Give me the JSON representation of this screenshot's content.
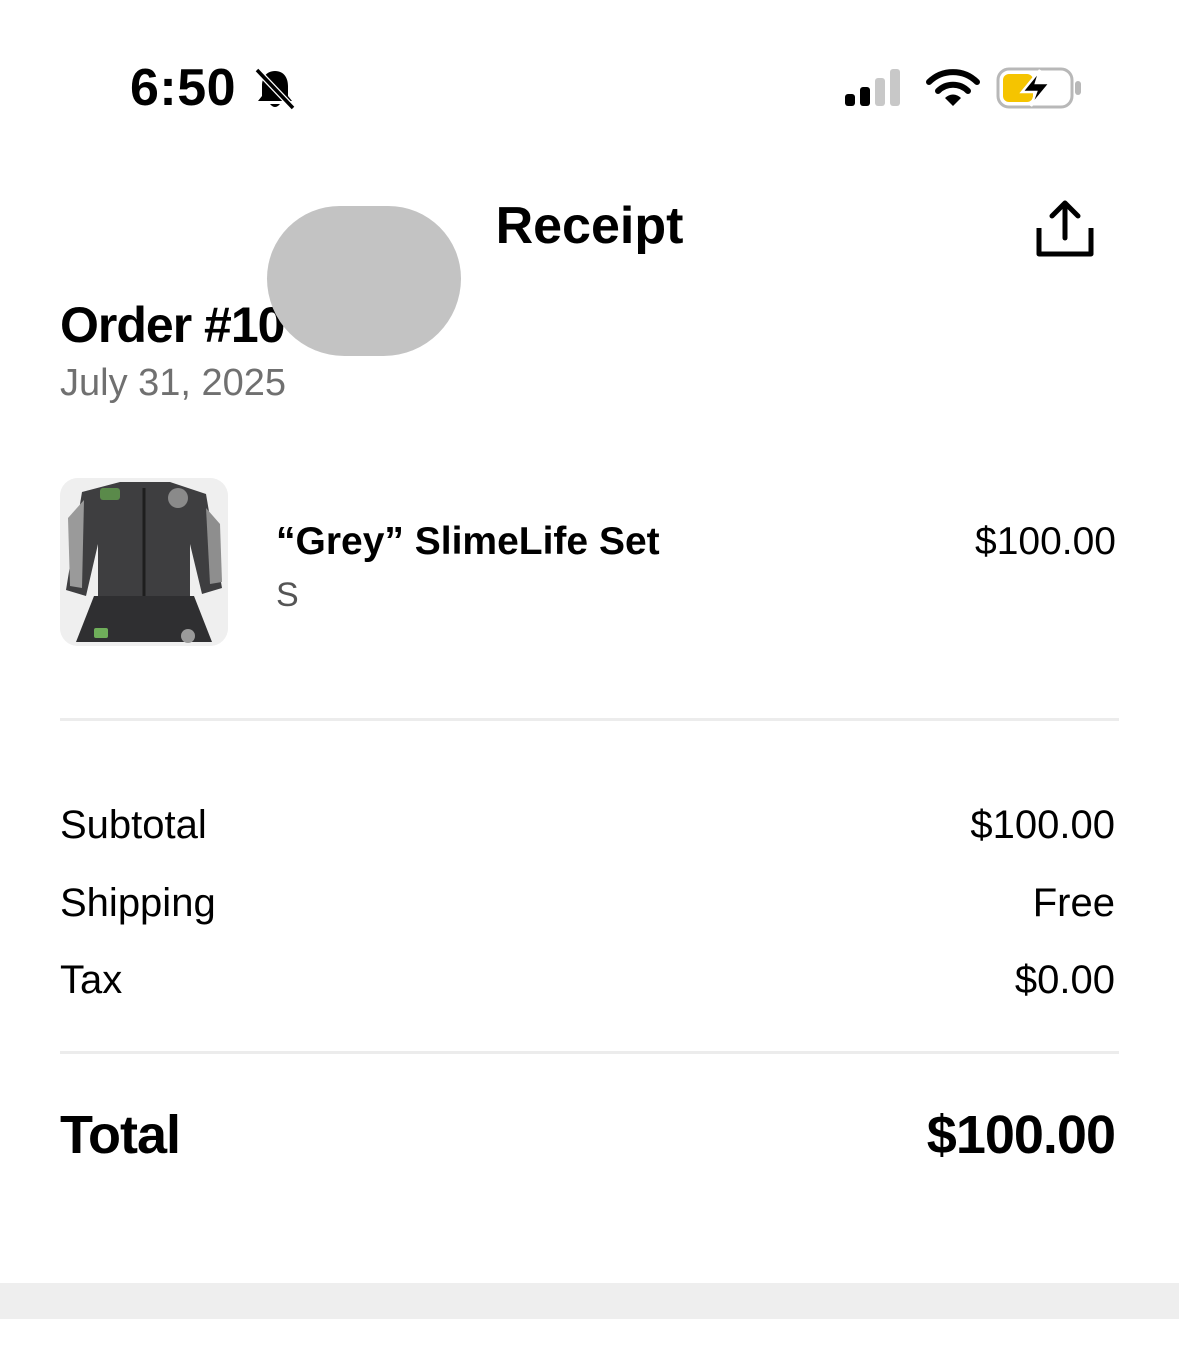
{
  "status_bar": {
    "time": "6:50",
    "silent_icon": "bell-slash-icon",
    "signal_icon": "cellular-signal-icon",
    "wifi_icon": "wifi-icon",
    "battery_icon": "battery-charging-icon",
    "battery_color": "#f5c400"
  },
  "header": {
    "title": "Receipt",
    "share_icon": "share-icon"
  },
  "order": {
    "number": "Order #10",
    "date": "July 31, 2025"
  },
  "item": {
    "name": "“Grey” SlimeLife Set",
    "variant": "S",
    "price": "$100.00"
  },
  "summary": {
    "rows": [
      {
        "label": "Subtotal",
        "value": "$100.00"
      },
      {
        "label": "Shipping",
        "value": "Free"
      },
      {
        "label": "Tax",
        "value": "$0.00"
      }
    ],
    "total_label": "Total",
    "total_value": "$100.00"
  }
}
